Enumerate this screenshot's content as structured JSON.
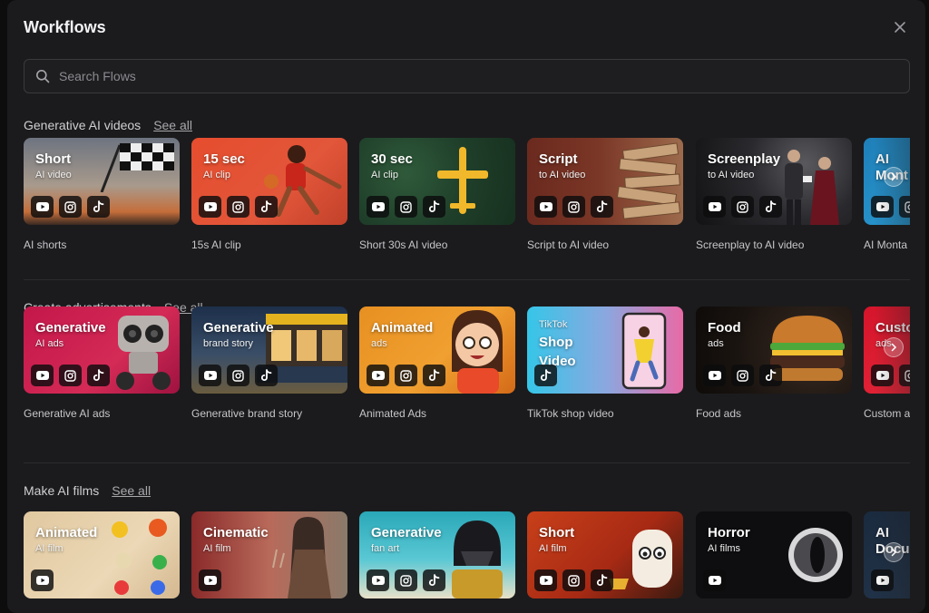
{
  "window": {
    "title": "Workflows"
  },
  "search": {
    "placeholder": "Search Flows",
    "value": ""
  },
  "see_all_label": "See all",
  "sections": [
    {
      "title": "Generative AI videos",
      "cards": [
        {
          "title": "Short",
          "subtitle": "AI video",
          "label": "AI shorts",
          "platforms": [
            "youtube",
            "instagram",
            "tiktok"
          ]
        },
        {
          "title": "15 sec",
          "subtitle": "AI clip",
          "label": "15s AI clip",
          "platforms": [
            "youtube",
            "instagram",
            "tiktok"
          ]
        },
        {
          "title": "30 sec",
          "subtitle": "AI clip",
          "label": "Short 30s AI video",
          "platforms": [
            "youtube",
            "instagram",
            "tiktok"
          ]
        },
        {
          "title": "Script",
          "subtitle": "to AI video",
          "label": "Script to AI video",
          "platforms": [
            "youtube",
            "instagram",
            "tiktok"
          ]
        },
        {
          "title": "Screenplay",
          "subtitle": "to AI video",
          "label": "Screenplay to AI video",
          "platforms": [
            "youtube",
            "instagram",
            "tiktok"
          ]
        },
        {
          "title": "AI Mont",
          "subtitle": "",
          "label": "AI Monta",
          "platforms": [
            "youtube",
            "instagram"
          ]
        }
      ]
    },
    {
      "title": "Create advertisements",
      "cards": [
        {
          "title": "Generative",
          "subtitle": "AI ads",
          "label": "Generative AI ads",
          "platforms": [
            "youtube",
            "instagram",
            "tiktok"
          ]
        },
        {
          "title": "Generative",
          "subtitle": "brand story",
          "label": "Generative brand story",
          "platforms": [
            "youtube",
            "instagram",
            "tiktok"
          ]
        },
        {
          "title": "Animated",
          "subtitle": "ads",
          "label": "Animated Ads",
          "platforms": [
            "youtube",
            "instagram",
            "tiktok"
          ]
        },
        {
          "title": "Shop Video",
          "subtitle": "TikTok",
          "label": "TikTok shop video",
          "platforms": [
            "tiktok"
          ]
        },
        {
          "title": "Food",
          "subtitle": "ads",
          "label": "Food ads",
          "platforms": [
            "youtube",
            "instagram",
            "tiktok"
          ]
        },
        {
          "title": "Custo",
          "subtitle": "ads",
          "label": "Custom a",
          "platforms": [
            "youtube",
            "instagram"
          ]
        }
      ]
    },
    {
      "title": "Make AI films",
      "cards": [
        {
          "title": "Animated",
          "subtitle": "AI film",
          "label": "",
          "platforms": [
            "youtube"
          ]
        },
        {
          "title": "Cinematic",
          "subtitle": "AI film",
          "label": "",
          "platforms": [
            "youtube"
          ]
        },
        {
          "title": "Generative",
          "subtitle": "fan art",
          "label": "",
          "platforms": [
            "youtube",
            "instagram",
            "tiktok"
          ]
        },
        {
          "title": "Short",
          "subtitle": "AI film",
          "label": "",
          "platforms": [
            "youtube",
            "instagram",
            "tiktok"
          ]
        },
        {
          "title": "Horror",
          "subtitle": "AI films",
          "label": "",
          "platforms": [
            "youtube"
          ]
        },
        {
          "title": "AI Docu",
          "subtitle": "",
          "label": "",
          "platforms": [
            "youtube"
          ]
        }
      ]
    }
  ]
}
